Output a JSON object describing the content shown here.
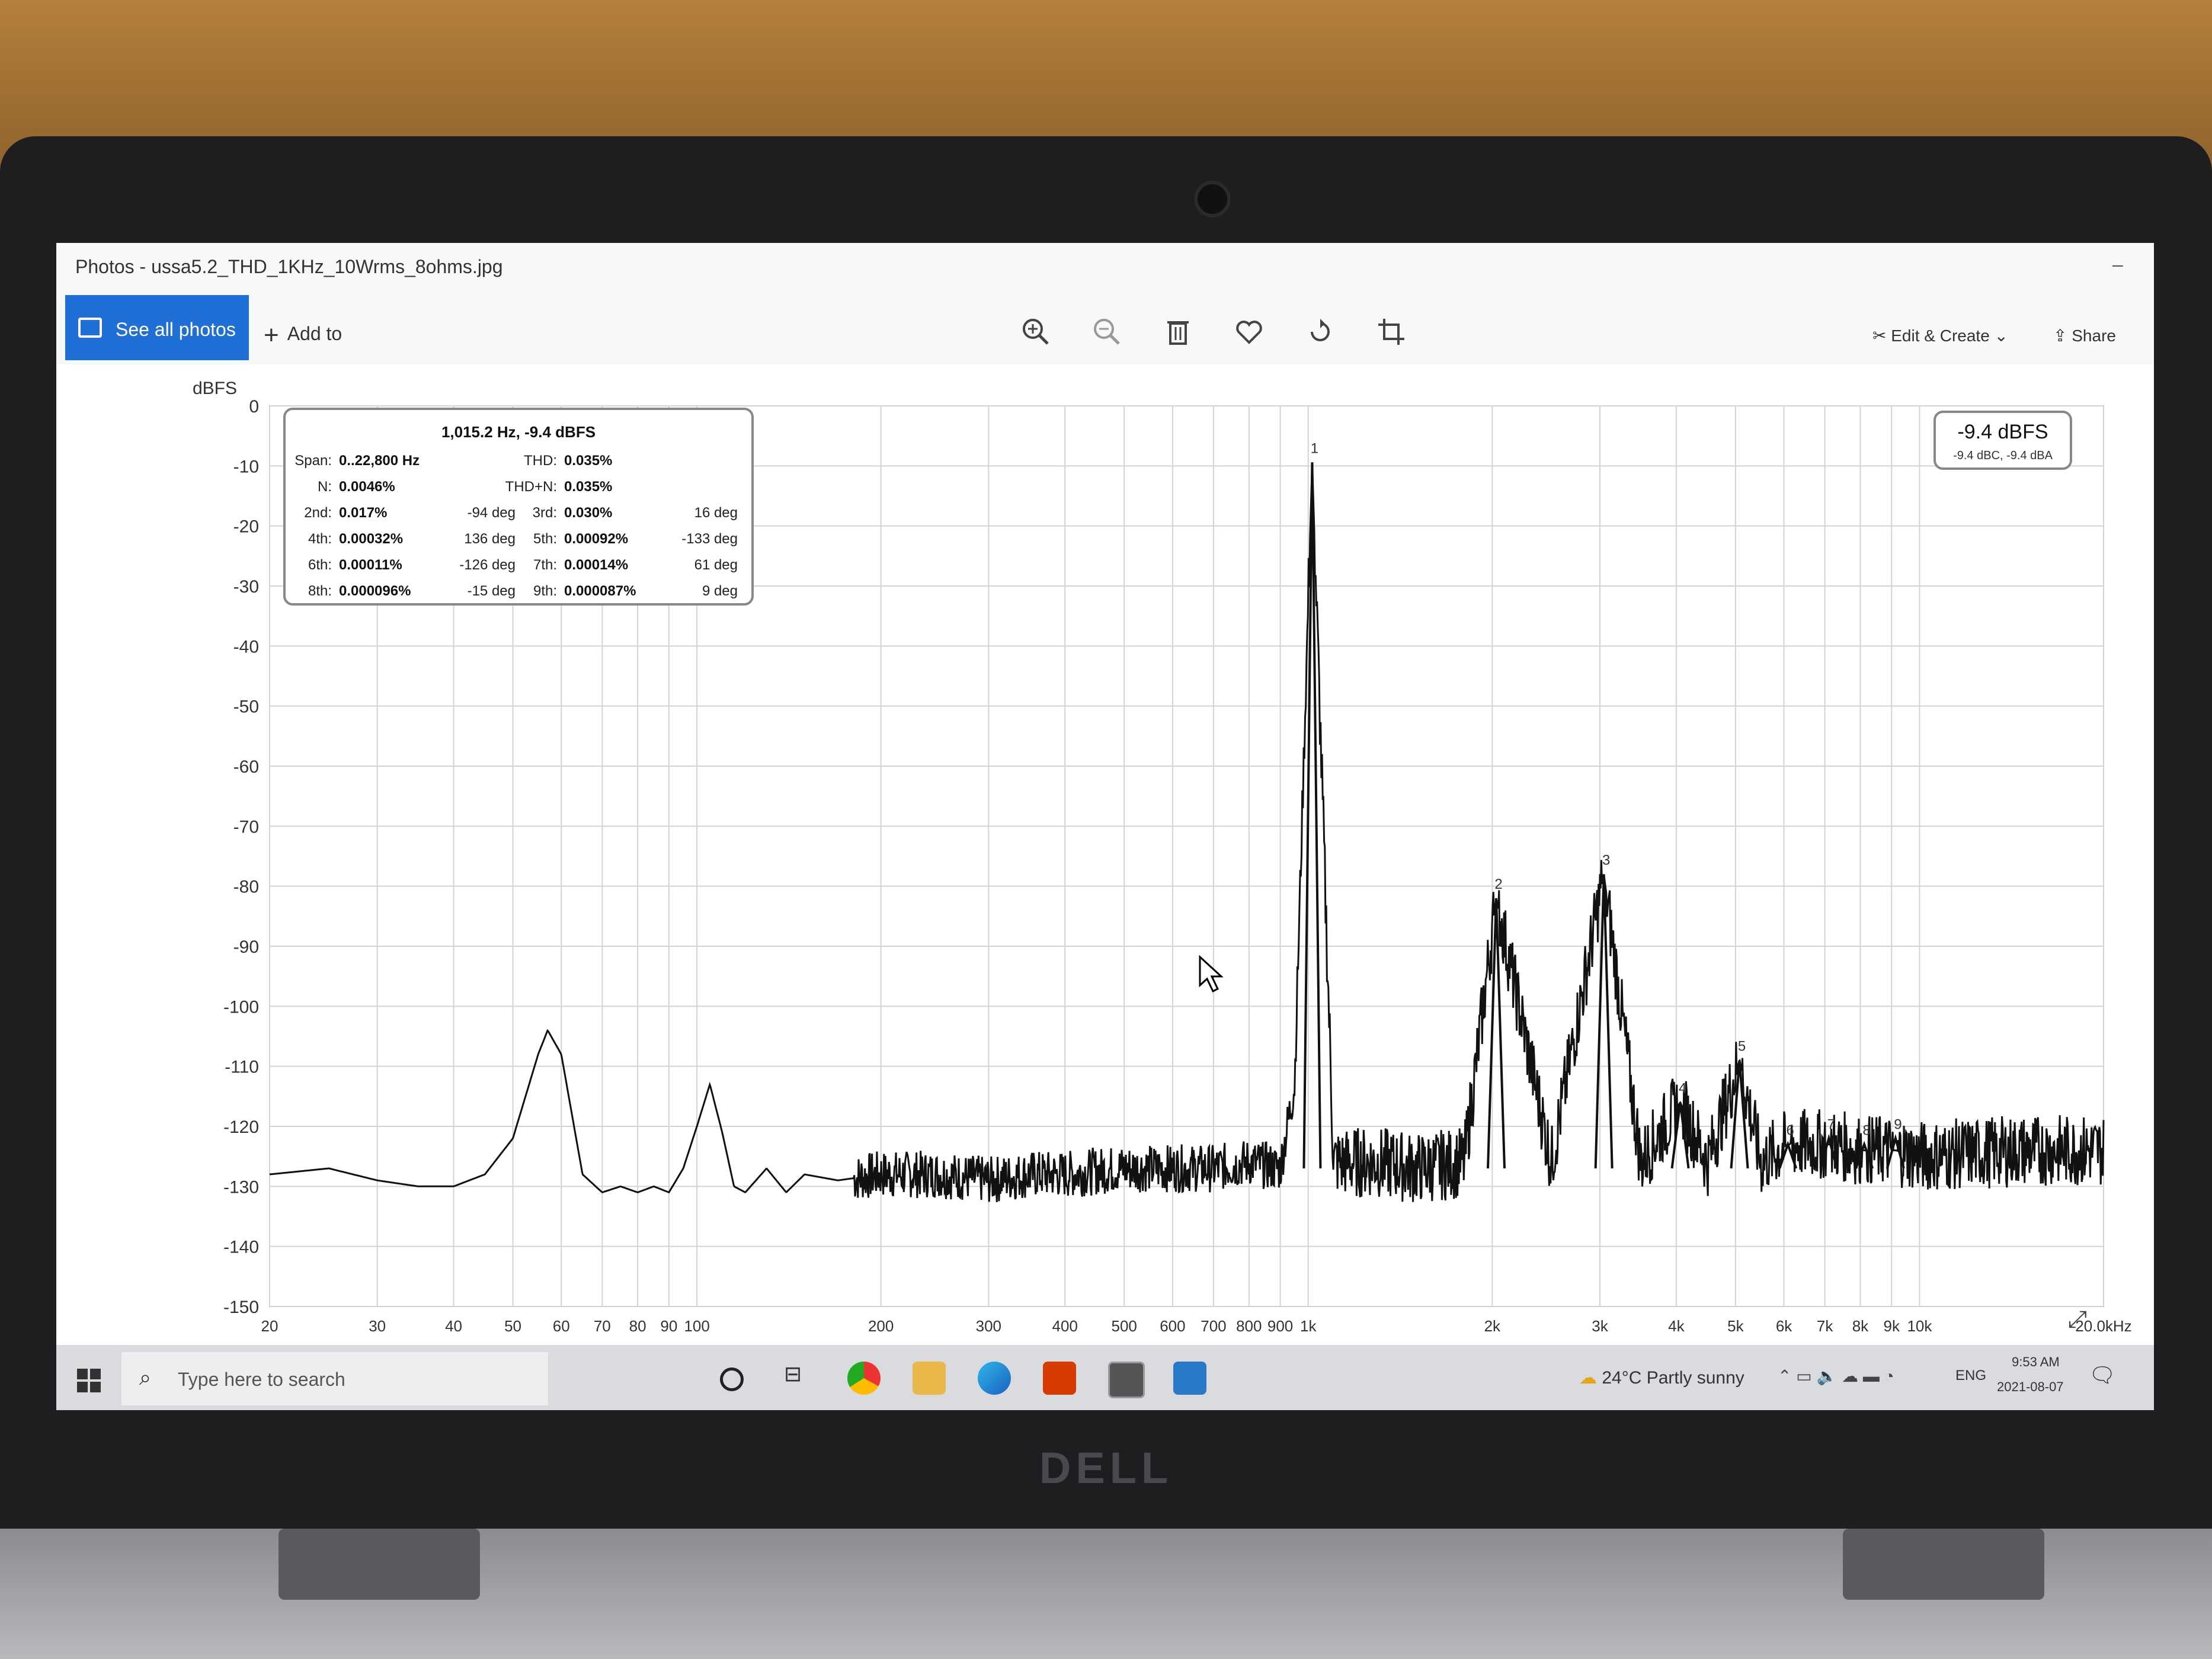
{
  "window": {
    "title": "Photos - ussa5.2_THD_1KHz_10Wrms_8ohms.jpg"
  },
  "toolbar": {
    "see_all_label": "See all photos",
    "add_to_label": "Add to",
    "edit_create_label": "Edit & Create",
    "share_label": "Share",
    "icons": [
      "zoom-in-icon",
      "zoom-out-icon",
      "delete-icon",
      "favorite-icon",
      "rotate-icon",
      "crop-icon"
    ]
  },
  "chart_data": {
    "type": "line",
    "ylabel": "dBFS",
    "x_scale": "log",
    "xlim": [
      20,
      20000
    ],
    "ylim": [
      -150,
      0
    ],
    "y_ticks": [
      "0",
      "-10",
      "-20",
      "-30",
      "-40",
      "-50",
      "-60",
      "-70",
      "-80",
      "-90",
      "-100",
      "-110",
      "-120",
      "-130",
      "-140",
      "-150"
    ],
    "x_ticks": [
      {
        "v": 20,
        "label": "20"
      },
      {
        "v": 30,
        "label": "30"
      },
      {
        "v": 40,
        "label": "40"
      },
      {
        "v": 50,
        "label": "50"
      },
      {
        "v": 60,
        "label": "60"
      },
      {
        "v": 70,
        "label": "70"
      },
      {
        "v": 80,
        "label": "80"
      },
      {
        "v": 90,
        "label": "90"
      },
      {
        "v": 100,
        "label": "100"
      },
      {
        "v": 200,
        "label": "200"
      },
      {
        "v": 300,
        "label": "300"
      },
      {
        "v": 400,
        "label": "400"
      },
      {
        "v": 500,
        "label": "500"
      },
      {
        "v": 600,
        "label": "600"
      },
      {
        "v": 700,
        "label": "700"
      },
      {
        "v": 800,
        "label": "800"
      },
      {
        "v": 900,
        "label": "900"
      },
      {
        "v": 1000,
        "label": "1k"
      },
      {
        "v": 2000,
        "label": "2k"
      },
      {
        "v": 3000,
        "label": "3k"
      },
      {
        "v": 4000,
        "label": "4k"
      },
      {
        "v": 5000,
        "label": "5k"
      },
      {
        "v": 6000,
        "label": "6k"
      },
      {
        "v": 7000,
        "label": "7k"
      },
      {
        "v": 8000,
        "label": "8k"
      },
      {
        "v": 9000,
        "label": "9k"
      },
      {
        "v": 10000,
        "label": "10k"
      },
      {
        "v": 20000,
        "label": "20.0kHz"
      }
    ],
    "grid": true,
    "series": [
      {
        "x": [
          20,
          25,
          30,
          35,
          40,
          45,
          50,
          55,
          57,
          60,
          65,
          70,
          75,
          80,
          85,
          90,
          95,
          100,
          105,
          110,
          115,
          120,
          130,
          140,
          150,
          170,
          200,
          250,
          300,
          350,
          400,
          500,
          600,
          700,
          800,
          900,
          950,
          1015,
          1100,
          1300,
          1500,
          1800,
          2030,
          2500,
          3045,
          3500,
          4060,
          4500,
          5075,
          5500,
          6090,
          7105,
          8120,
          9135,
          10000,
          15000,
          20000
        ],
        "y": [
          -128,
          -127,
          -129,
          -130,
          -130,
          -128,
          -122,
          -108,
          -104,
          -108,
          -128,
          -131,
          -130,
          -131,
          -130,
          -131,
          -127,
          -120,
          -113,
          -121,
          -130,
          -131,
          -127,
          -131,
          -128,
          -129,
          -128,
          -128,
          -129,
          -128,
          -128,
          -127,
          -127,
          -127,
          -126,
          -127,
          -113,
          -9.4,
          -126,
          -126,
          -127,
          -126,
          -82,
          -126,
          -78,
          -126,
          -116,
          -126,
          -109,
          -126,
          -123,
          -123,
          -124,
          -124,
          -125,
          -124,
          -124
        ]
      }
    ],
    "harmonics": [
      {
        "label": "1",
        "freq": 1015,
        "db": -9.4
      },
      {
        "label": "2",
        "freq": 2030,
        "db": -82
      },
      {
        "label": "3",
        "freq": 3045,
        "db": -78
      },
      {
        "label": "4",
        "freq": 4060,
        "db": -116
      },
      {
        "label": "5",
        "freq": 5075,
        "db": -109
      },
      {
        "label": "6",
        "freq": 6090,
        "db": -123
      },
      {
        "label": "7",
        "freq": 7105,
        "db": -122
      },
      {
        "label": "8",
        "freq": 8120,
        "db": -123
      },
      {
        "label": "9",
        "freq": 9135,
        "db": -122
      }
    ],
    "info_box": {
      "title": "1,015.2 Hz, -9.4 dBFS",
      "rows": [
        [
          {
            "k": "Span:",
            "v": "0..22,800 Hz"
          },
          {
            "k": "THD:",
            "v": "0.035%"
          }
        ],
        [
          {
            "k": "N:",
            "v": "0.0046%"
          },
          {
            "k": "THD+N:",
            "v": "0.035%"
          }
        ],
        [
          {
            "k": "2nd:",
            "v": "0.017%",
            "p": "-94 deg"
          },
          {
            "k": "3rd:",
            "v": "0.030%",
            "p": "16 deg"
          }
        ],
        [
          {
            "k": "4th:",
            "v": "0.00032%",
            "p": "136 deg"
          },
          {
            "k": "5th:",
            "v": "0.00092%",
            "p": "-133 deg"
          }
        ],
        [
          {
            "k": "6th:",
            "v": "0.00011%",
            "p": "-126 deg"
          },
          {
            "k": "7th:",
            "v": "0.00014%",
            "p": "61 deg"
          }
        ],
        [
          {
            "k": "8th:",
            "v": "0.000096%",
            "p": "-15 deg"
          },
          {
            "k": "9th:",
            "v": "0.000087%",
            "p": "9 deg"
          }
        ]
      ]
    },
    "level_badge": {
      "main": "-9.4 dBFS",
      "sub": "-9.4 dBC, -9.4 dBA"
    }
  },
  "taskbar": {
    "search_placeholder": "Type here to search",
    "weather": "24°C  Partly sunny",
    "lang": "ENG",
    "time": "9:53 AM",
    "date": "2021-08-07",
    "colors": {
      "accent": "#1f6fd6"
    }
  },
  "laptop": {
    "brand": "DELL"
  }
}
